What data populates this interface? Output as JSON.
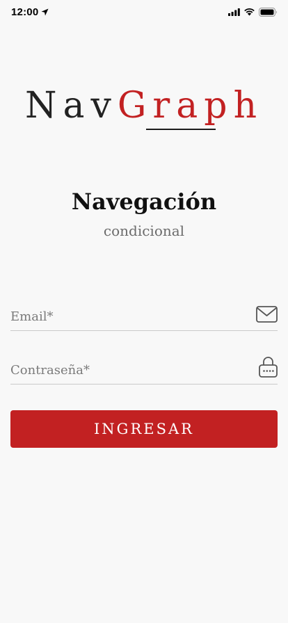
{
  "status_bar": {
    "time": "12:00",
    "icons": [
      "location-arrow-icon",
      "signal-icon",
      "wifi-icon",
      "battery-icon"
    ]
  },
  "logo": {
    "part1": "Nav",
    "part2": "Graph",
    "colors": {
      "part1": "#222222",
      "part2": "#c22122"
    }
  },
  "heading": {
    "title": "Navegación",
    "subtitle": "condicional"
  },
  "form": {
    "email": {
      "placeholder": "Email*",
      "value": "",
      "icon": "mail-icon"
    },
    "password": {
      "placeholder": "Contraseña*",
      "value": "",
      "icon": "lock-icon"
    },
    "submit_label": "INGRESAR"
  },
  "theme": {
    "accent": "#c22122",
    "background": "#f8f8f8"
  }
}
